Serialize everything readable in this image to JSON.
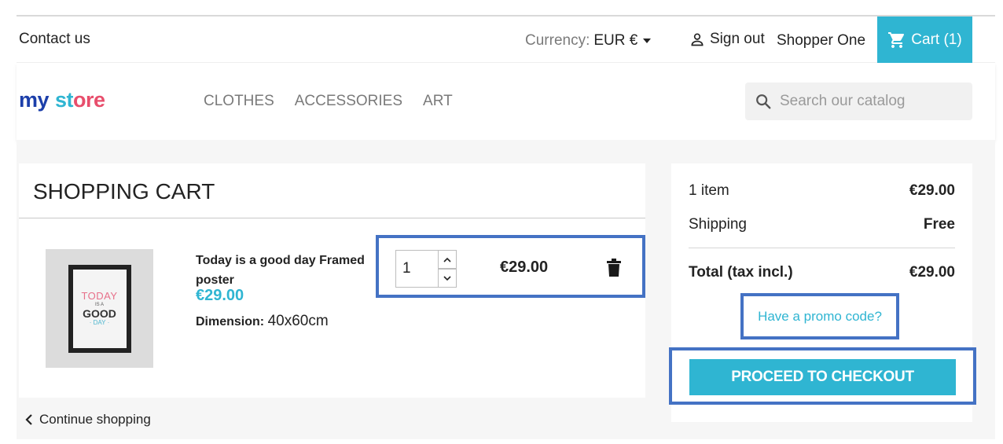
{
  "topbar": {
    "contact_label": "Contact us",
    "currency_label": "Currency:",
    "currency_value": "EUR €",
    "signout_label": "Sign out",
    "user_name": "Shopper One",
    "cart_label": "Cart (1)"
  },
  "header": {
    "logo": {
      "part1": "my",
      "part2": "st",
      "part3": "ore"
    },
    "nav": [
      "CLOTHES",
      "ACCESSORIES",
      "ART"
    ],
    "search_placeholder": "Search our catalog"
  },
  "cart": {
    "title": "SHOPPING CART",
    "items": [
      {
        "name": "Today is a good day Framed poster",
        "price": "€29.00",
        "attr_label": "Dimension:",
        "attr_value": "40x60cm",
        "quantity": "1",
        "line_total": "€29.00",
        "poster": {
          "line1": "TODAY",
          "line2": "IS A",
          "line3": "GOOD",
          "line4": "· DAY ·"
        }
      }
    ],
    "continue_label": "Continue shopping"
  },
  "summary": {
    "items_label": "1 item",
    "items_amount": "€29.00",
    "shipping_label": "Shipping",
    "shipping_amount": "Free",
    "total_label": "Total (tax incl.)",
    "total_amount": "€29.00",
    "promo_label": "Have a promo code?",
    "checkout_label": "PROCEED TO CHECKOUT"
  },
  "colors": {
    "accent": "#2fb5d2",
    "highlight_border": "#4472c4",
    "text": "#232323",
    "muted": "#7a7a7a"
  }
}
